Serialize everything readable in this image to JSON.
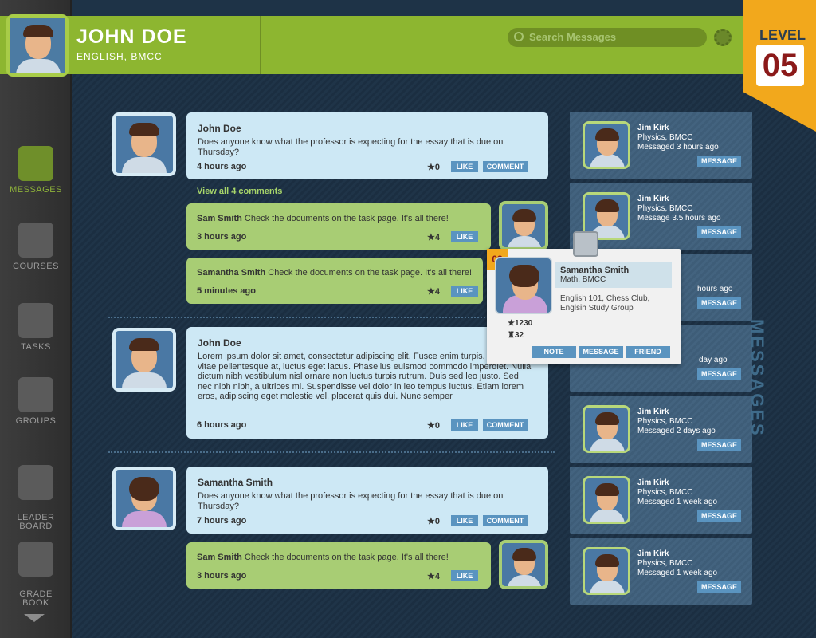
{
  "header": {
    "name": "JOHN DOE",
    "subtitle": "ENGLISH, BMCC",
    "search_placeholder": "Search Messages",
    "level_label": "LEVEL",
    "level_value": "05"
  },
  "sidebar": {
    "items": [
      {
        "label": "MESSAGES",
        "icon": "chat-icon",
        "active": true
      },
      {
        "label": "COURSES",
        "icon": "courses-icon"
      },
      {
        "label": "TASKS",
        "icon": "tasks-icon"
      },
      {
        "label": "GROUPS",
        "icon": "groups-icon"
      },
      {
        "label": "LEADER\nBOARD",
        "icon": "trophy-icon"
      },
      {
        "label": "GRADE\nBOOK",
        "icon": "grade-icon"
      }
    ]
  },
  "feed": {
    "post1": {
      "name": "John Doe",
      "text": "Does anyone know what the professor is expecting for the essay that is due on Thursday?",
      "time": "4 hours ago",
      "stars": "0",
      "like": "LIKE",
      "comment": "COMMENT"
    },
    "view_all": "View all 4 comments",
    "reply1": {
      "name": "Sam Smith",
      "text": "Check the documents on the task page. It's all there!",
      "time": "3 hours ago",
      "stars": "4",
      "like": "LIKE"
    },
    "reply2": {
      "name": "Samantha Smith",
      "text": "Check the documents on the task page. It's all there!",
      "time": "5 minutes ago",
      "stars": "4",
      "like": "LIKE"
    },
    "post2": {
      "name": "John Doe",
      "text": "Lorem ipsum dolor sit amet, consectetur adipiscing elit. Fusce enim turpis, malesuada vitae pellentesque at, luctus eget lacus. Phasellus euismod commodo imperdiet. Nulla dictum nibh vestibulum nisl ornare non luctus turpis rutrum. Duis sed leo justo. Sed nec nibh nibh, a ultrices mi. Suspendisse vel dolor in leo tempus luctus. Etiam lorem eros, adipiscing eget molestie vel, placerat quis dui. Nunc semper",
      "time": "6 hours ago",
      "stars": "0",
      "like": "LIKE",
      "comment": "COMMENT"
    },
    "post3": {
      "name": "Samantha Smith",
      "text": "Does anyone know what the professor is expecting for the essay that is due on Thursday?",
      "time": "7 hours ago",
      "stars": "0",
      "like": "LIKE",
      "comment": "COMMENT"
    },
    "reply3": {
      "name": "Sam Smith",
      "text": "Check the documents on the task page. It's all there!",
      "time": "3 hours ago",
      "stars": "4",
      "like": "LIKE"
    }
  },
  "contacts": [
    {
      "name": "Jim Kirk",
      "school": "Physics, BMCC",
      "time": "Messaged 3 hours ago",
      "button": "MESSAGE"
    },
    {
      "name": "Jim Kirk",
      "school": "Physics, BMCC",
      "time": "Message 3.5 hours ago",
      "button": "MESSAGE"
    },
    {
      "name": "",
      "school": "",
      "time": "hours ago",
      "button": "MESSAGE"
    },
    {
      "name": "",
      "school": "",
      "time": "day ago",
      "button": "MESSAGE"
    },
    {
      "name": "Jim Kirk",
      "school": "Physics, BMCC",
      "time": "Messaged 2 days ago",
      "button": "MESSAGE"
    },
    {
      "name": "Jim Kirk",
      "school": "Physics, BMCC",
      "time": "Messaged 1 week ago",
      "button": "MESSAGE"
    },
    {
      "name": "Jim Kirk",
      "school": "Physics, BMCC",
      "time": "Messaged 1 week ago",
      "button": "MESSAGE"
    }
  ],
  "panel_title": "MESSAGES",
  "popup": {
    "badge": "03",
    "name": "Samantha Smith",
    "school": "Math, BMCC",
    "details": "English 101, Chess Club, Englsih Study Group",
    "points": "1230",
    "trophies": "32",
    "note": "NOTE",
    "message": "MESSAGE",
    "friend": "FRIEND"
  }
}
